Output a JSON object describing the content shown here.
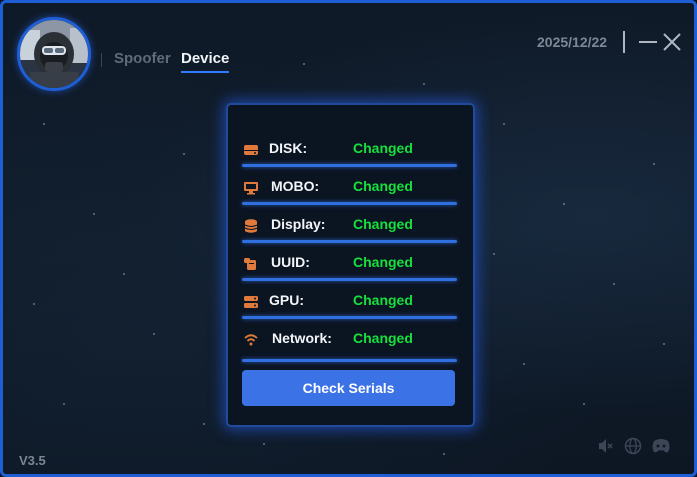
{
  "nav": {
    "tabs": [
      {
        "label": "Spoofer",
        "active": false
      },
      {
        "label": "Device",
        "active": true
      }
    ]
  },
  "header": {
    "date": "2025/12/22"
  },
  "card": {
    "rows": [
      {
        "icon": "hard-drive-icon",
        "label": "DISK:",
        "status": "Changed"
      },
      {
        "icon": "monitor-icon",
        "label": "MOBO:",
        "status": "Changed"
      },
      {
        "icon": "database-icon",
        "label": "Display:",
        "status": "Changed"
      },
      {
        "icon": "scroll-icon",
        "label": "UUID:",
        "status": "Changed"
      },
      {
        "icon": "server-icon",
        "label": "GPU:",
        "status": "Changed"
      },
      {
        "icon": "wifi-icon",
        "label": "Network:",
        "status": "Changed"
      }
    ],
    "button_label": "Check Serials"
  },
  "footer": {
    "version": "V3.5",
    "icons": [
      "mute-icon",
      "globe-icon",
      "discord-icon"
    ]
  },
  "colors": {
    "accent": "#2f6fe0",
    "border": "#1f5fd6",
    "status_ok": "#16e03c",
    "icon_orange": "#e07a3c",
    "button": "#3b72e6"
  }
}
